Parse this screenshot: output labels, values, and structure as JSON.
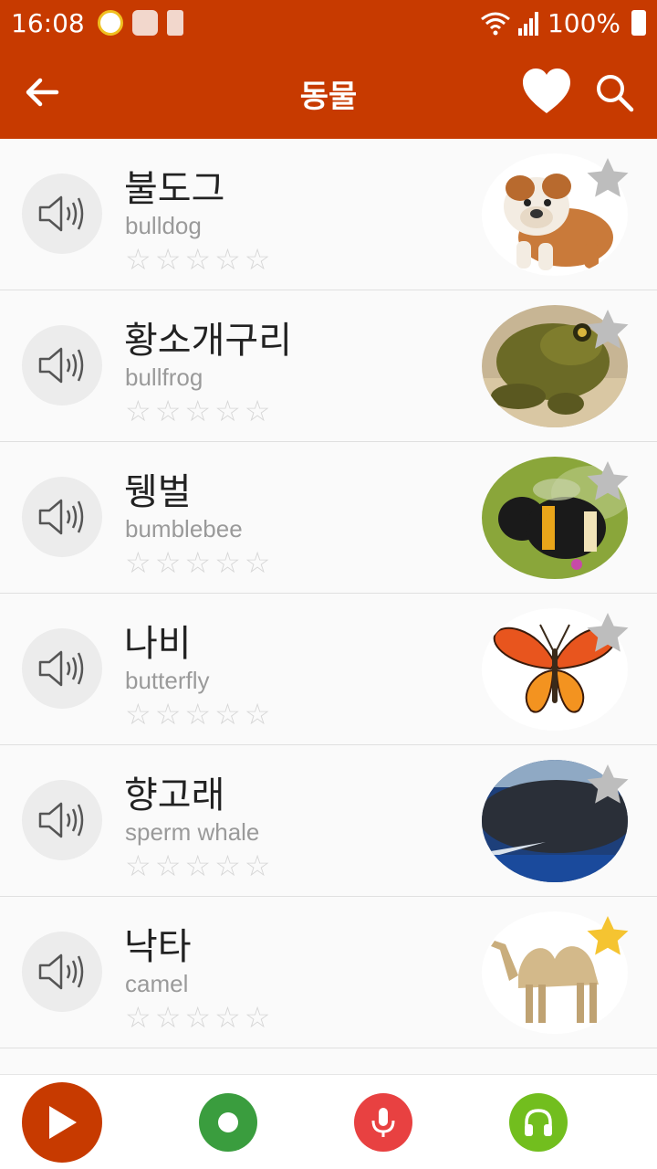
{
  "status_bar": {
    "time": "16:08",
    "battery_pct": "100%",
    "icons": [
      "globe-app-icon",
      "clock-app-icon",
      "battery-saver-icon",
      "wifi-icon",
      "signal-icon",
      "battery-icon"
    ]
  },
  "app_bar": {
    "title": "동물",
    "icons": [
      "back-arrow-icon",
      "heart-icon",
      "search-icon"
    ]
  },
  "colors": {
    "primary": "#c73a00",
    "star_inactive": "#bdbdbd",
    "star_active": "#f5c431",
    "record": "#3a9d3e",
    "mic": "#e84141",
    "listen": "#72be1e"
  },
  "items": [
    {
      "word": "불도그",
      "translation": "bulldog",
      "rating": 0,
      "favorite": false,
      "image": "bulldog"
    },
    {
      "word": "황소개구리",
      "translation": "bullfrog",
      "rating": 0,
      "favorite": false,
      "image": "bullfrog"
    },
    {
      "word": "뒝벌",
      "translation": "bumblebee",
      "rating": 0,
      "favorite": false,
      "image": "bumblebee"
    },
    {
      "word": "나비",
      "translation": "butterfly",
      "rating": 0,
      "favorite": false,
      "image": "butterfly"
    },
    {
      "word": "향고래",
      "translation": "sperm whale",
      "rating": 0,
      "favorite": false,
      "image": "sperm whale"
    },
    {
      "word": "낙타",
      "translation": "camel",
      "rating": 0,
      "favorite": true,
      "image": "camel"
    }
  ],
  "bottom_bar": {
    "buttons": [
      "play-button",
      "record-button",
      "microphone-button",
      "headphones-button"
    ]
  }
}
